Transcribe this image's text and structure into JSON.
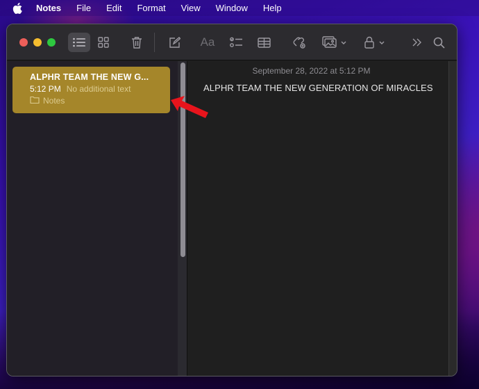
{
  "menubar": {
    "apple_icon": "apple-logo",
    "app_name": "Notes",
    "items": [
      "File",
      "Edit",
      "Format",
      "View",
      "Window",
      "Help"
    ]
  },
  "toolbar": {
    "buttons": [
      {
        "name": "list-view",
        "icon": "list-icon",
        "active": true
      },
      {
        "name": "gallery-view",
        "icon": "grid-icon",
        "active": false
      },
      {
        "name": "delete",
        "icon": "trash-icon",
        "active": false
      },
      {
        "name": "new-note",
        "icon": "compose-icon",
        "active": false
      },
      {
        "name": "format",
        "icon": "text-format-icon",
        "label": "Aa",
        "active": false
      },
      {
        "name": "checklist",
        "icon": "checklist-icon",
        "active": false
      },
      {
        "name": "table",
        "icon": "table-icon",
        "active": false
      },
      {
        "name": "collaborate",
        "icon": "collaborate-icon",
        "active": false
      },
      {
        "name": "media",
        "icon": "photo-icon",
        "active": false
      },
      {
        "name": "lock",
        "icon": "lock-icon",
        "active": false
      },
      {
        "name": "more",
        "icon": "chevrons-right-icon",
        "active": false
      },
      {
        "name": "search",
        "icon": "search-icon",
        "active": false
      }
    ]
  },
  "notes_list": [
    {
      "title": "ALPHR TEAM THE NEW G...",
      "time": "5:12 PM",
      "preview": "No additional text",
      "folder": "Notes",
      "selected": true
    }
  ],
  "editor": {
    "date": "September 28, 2022 at 5:12 PM",
    "body": "ALPHR TEAM THE NEW GENERATION OF MIRACLES"
  },
  "colors": {
    "selected_note": "#a5862a",
    "annotation_arrow": "#e8141c"
  }
}
